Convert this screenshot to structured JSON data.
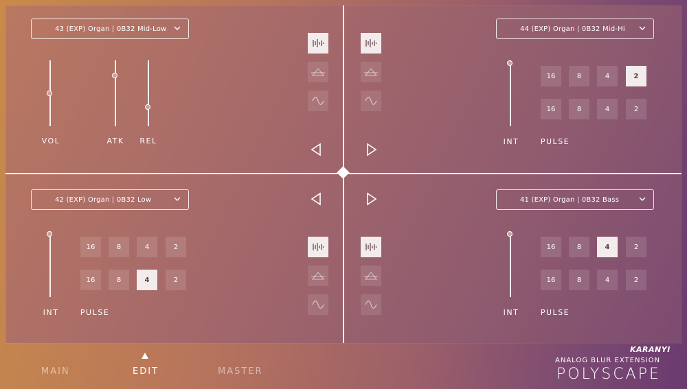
{
  "quadrants": {
    "top_left": {
      "preset": "43 (EXP) Organ | 0B32 Mid-Low",
      "sliders": [
        {
          "label": "VOL",
          "value": 0.52
        },
        {
          "label": "ATK",
          "value": 0.8
        },
        {
          "label": "REL",
          "value": 0.3
        }
      ],
      "prev_icon": "triangle-left-icon"
    },
    "top_right": {
      "preset": "44 (EXP) Organ | 0B32 Mid-Hi",
      "int_label": "INT",
      "pulse_label": "PULSE",
      "int_value": 0.97,
      "row1": [
        "16",
        "8",
        "4",
        "2"
      ],
      "row2": [
        "16",
        "8",
        "4",
        "2"
      ],
      "row1_selected": "2",
      "next_icon": "triangle-right-icon"
    },
    "bottom_left": {
      "preset": "42 (EXP) Organ | 0B32 Low",
      "int_label": "INT",
      "pulse_label": "PULSE",
      "int_value": 0.97,
      "row1": [
        "16",
        "8",
        "4",
        "2"
      ],
      "row2": [
        "16",
        "8",
        "4",
        "2"
      ],
      "row2_selected": "4",
      "prev_icon": "triangle-left-icon"
    },
    "bottom_right": {
      "preset": "41 (EXP) Organ | 0B32 Bass",
      "int_label": "INT",
      "pulse_label": "PULSE",
      "int_value": 0.97,
      "row1": [
        "16",
        "8",
        "4",
        "2"
      ],
      "row2": [
        "16",
        "8",
        "4",
        "2"
      ],
      "row1_selected": "4",
      "next_icon": "triangle-right-icon"
    }
  },
  "mode_icons": [
    "waveform-icon",
    "prism-icon",
    "sine-wave-icon"
  ],
  "nav": {
    "tabs": [
      "MAIN",
      "EDIT",
      "MASTER"
    ],
    "active": "EDIT"
  },
  "brand": {
    "logo": "KARANYI",
    "subtitle": "ANALOG BLUR EXTENSION",
    "title": "POLYSCAPE"
  },
  "colors": {
    "accent": "#ffffff",
    "active_button": "#f2ecec"
  }
}
